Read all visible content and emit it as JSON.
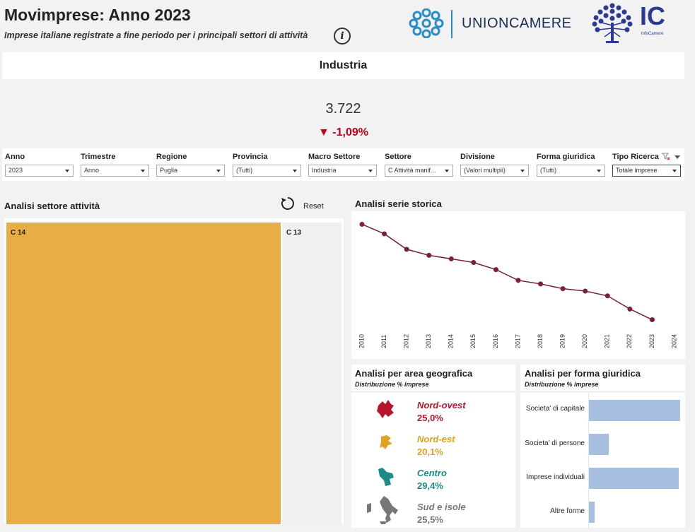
{
  "header": {
    "title": "Movimprese: Anno 2023",
    "subtitle": "Imprese italiane registrate a fine periodo per i principali settori di attività",
    "info_glyph": "i",
    "unioncamere_label": "UNIONCAMERE",
    "ic_label": "IC",
    "ic_sub": "InfoCamere"
  },
  "kpi": {
    "sector": "Industria",
    "value": "3.722",
    "delta": "▼ -1,09%",
    "delta_color": "#c00018"
  },
  "filters": [
    {
      "label": "Anno",
      "value": "2023"
    },
    {
      "label": "Trimestre",
      "value": "Anno"
    },
    {
      "label": "Regione",
      "value": "Puglia"
    },
    {
      "label": "Provincia",
      "value": "(Tutti)"
    },
    {
      "label": "Macro Settore",
      "value": "Industria"
    },
    {
      "label": "Settore",
      "value": "C Attività manif..."
    },
    {
      "label": "Divisione",
      "value": "(Valori multipli)"
    },
    {
      "label": "Forma giuridica",
      "value": "(Tutti)"
    },
    {
      "label": "Tipo Ricerca",
      "value": "Totale imprese"
    }
  ],
  "sector_panel": {
    "title": "Analisi settore attività",
    "reset_label": "Reset",
    "tiles": [
      {
        "label": "C 14",
        "color": "#e8ad44"
      },
      {
        "label": "C 13",
        "color": "#f0f0f0"
      }
    ]
  },
  "timeseries": {
    "title": "Analisi serie storica",
    "line_color": "#7a1f3d"
  },
  "chart_data": {
    "type": "line",
    "x": [
      "2010",
      "2011",
      "2012",
      "2013",
      "2014",
      "2015",
      "2016",
      "2017",
      "2018",
      "2019",
      "2020",
      "2021",
      "2022",
      "2023",
      "2024"
    ],
    "series": [
      {
        "values": [
          100,
          92,
          79,
          74,
          71,
          68,
          62,
          53,
          50,
          46,
          44,
          40,
          29,
          20,
          null
        ]
      }
    ],
    "xlabel": "",
    "ylabel": "",
    "ylim": [
      15,
      105
    ],
    "grid": false,
    "legend": "none"
  },
  "geo_panel": {
    "title": "Analisi per area geografica",
    "subtitle": "Distribuzione % imprese",
    "areas": [
      {
        "name": "Nord-ovest",
        "value": "25,0%",
        "color": "#b5162e"
      },
      {
        "name": "Nord-est",
        "value": "20,1%",
        "color": "#e0a020"
      },
      {
        "name": "Centro",
        "value": "29,4%",
        "color": "#1d8a8a"
      },
      {
        "name": "Sud e isole",
        "value": "25,5%",
        "color": "#777777"
      }
    ]
  },
  "legal_form_panel": {
    "title": "Analisi per forma giuridica",
    "subtitle": "Distribuzione % imprese",
    "bar_color": "#a6bfe0",
    "forms": [
      {
        "label": "Societa' di capitale",
        "share": 0.98
      },
      {
        "label": "Societa' di persone",
        "share": 0.21
      },
      {
        "label": "Imprese individuali",
        "share": 0.96
      },
      {
        "label": "Altre forme",
        "share": 0.06
      }
    ]
  }
}
